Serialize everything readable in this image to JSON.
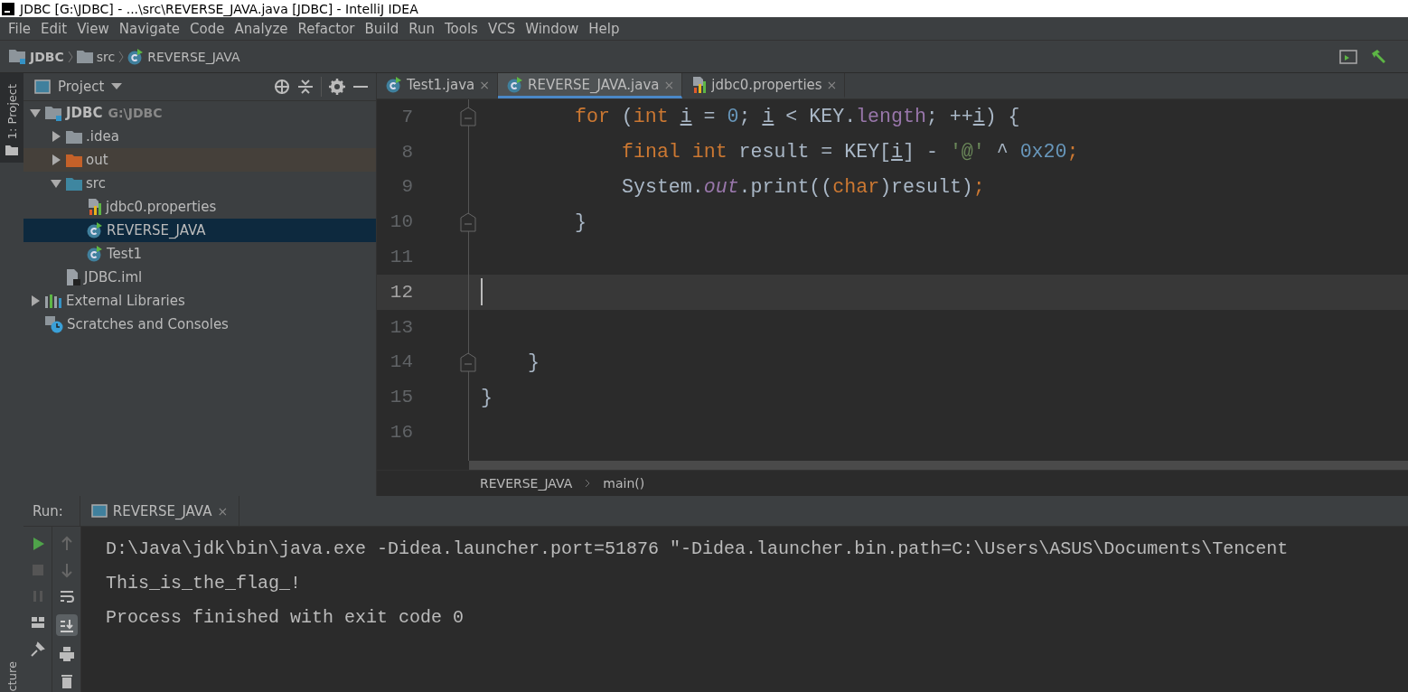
{
  "window": {
    "title": "JDBC [G:\\JDBC] - ...\\src\\REVERSE_JAVA.java [JDBC] - IntelliJ IDEA"
  },
  "menu": [
    "File",
    "Edit",
    "View",
    "Navigate",
    "Code",
    "Analyze",
    "Refactor",
    "Build",
    "Run",
    "Tools",
    "VCS",
    "Window",
    "Help"
  ],
  "navbar": [
    {
      "label": "JDBC",
      "kind": "project"
    },
    {
      "label": "src",
      "kind": "folder"
    },
    {
      "label": "REVERSE_JAVA",
      "kind": "class"
    }
  ],
  "side_strip": {
    "top": "1: Project",
    "bottom": "cture"
  },
  "project_panel": {
    "title": "Project",
    "tree": [
      {
        "label": "JDBC",
        "hint": "G:\\JDBC",
        "kind": "project",
        "expanded": true,
        "selected": false,
        "children": [
          {
            "label": ".idea",
            "kind": "folder",
            "expanded": false,
            "selected": false
          },
          {
            "label": "out",
            "kind": "excluded",
            "expanded": false,
            "selected": false
          },
          {
            "label": "src",
            "kind": "source",
            "expanded": true,
            "selected": false,
            "children": [
              {
                "label": "jdbc0.properties",
                "kind": "properties",
                "selected": false
              },
              {
                "label": "REVERSE_JAVA",
                "kind": "class",
                "selected": true
              },
              {
                "label": "Test1",
                "kind": "class",
                "selected": false
              }
            ]
          },
          {
            "label": "JDBC.iml",
            "kind": "module",
            "selected": false
          }
        ]
      },
      {
        "label": "External Libraries",
        "kind": "libraries",
        "expanded": false,
        "selected": false
      },
      {
        "label": "Scratches and Consoles",
        "kind": "scratches",
        "selected": false
      }
    ]
  },
  "editor_tabs": [
    {
      "label": "Test1.java",
      "kind": "class",
      "selected": false,
      "close": "×"
    },
    {
      "label": "REVERSE_JAVA.java",
      "kind": "class",
      "selected": true,
      "close": "×"
    },
    {
      "label": "jdbc0.properties",
      "kind": "properties",
      "selected": false,
      "close": "×"
    }
  ],
  "code": [
    {
      "children": [
        {
          "children": [
            {
              "number": "7",
              "fold": true,
              "current": false,
              "tokens": [
                {
                  "kind": "keyword",
                  "text": "for"
                },
                {
                  "kind": "plain",
                  "text": " ("
                },
                {
                  "kind": "keyword",
                  "text": "int "
                },
                {
                  "kind": "var",
                  "text": "i"
                },
                {
                  "kind": "plain",
                  "text": " = "
                },
                {
                  "kind": "number",
                  "text": "0"
                },
                {
                  "kind": "plain",
                  "text": "; "
                },
                {
                  "kind": "var",
                  "text": "i"
                },
                {
                  "kind": "plain",
                  "text": " < KEY."
                },
                {
                  "kind": "field",
                  "text": "length"
                },
                {
                  "kind": "plain",
                  "text": "; ++"
                },
                {
                  "kind": "var",
                  "text": "i"
                },
                {
                  "kind": "plain",
                  "text": ") {"
                }
              ],
              "children": [
                {
                  "number": "8",
                  "fold": false,
                  "current": false,
                  "tokens": [
                    {
                      "kind": "keyword",
                      "text": "final int "
                    },
                    {
                      "kind": "plain",
                      "text": "result = KEY["
                    },
                    {
                      "kind": "var",
                      "text": "i"
                    },
                    {
                      "kind": "plain",
                      "text": "] - "
                    },
                    {
                      "kind": "string",
                      "text": "'@'"
                    },
                    {
                      "kind": "plain",
                      "text": " ^ "
                    },
                    {
                      "kind": "number",
                      "text": "0x20"
                    },
                    {
                      "kind": "keyword",
                      "text": ";"
                    }
                  ]
                },
                {
                  "number": "9",
                  "fold": false,
                  "current": false,
                  "tokens": [
                    {
                      "kind": "plain",
                      "text": "System."
                    },
                    {
                      "kind": "static",
                      "text": "out"
                    },
                    {
                      "kind": "plain",
                      "text": ".print(("
                    },
                    {
                      "kind": "keyword",
                      "text": "char"
                    },
                    {
                      "kind": "plain",
                      "text": ")result)"
                    },
                    {
                      "kind": "keyword",
                      "text": ";"
                    }
                  ]
                }
              ]
            },
            {
              "number": "10",
              "fold": true,
              "current": false,
              "tokens": [
                {
                  "kind": "plain",
                  "text": "}"
                }
              ]
            },
            {
              "number": "11",
              "fold": false,
              "current": false
            },
            {
              "number": "12",
              "fold": false,
              "current": true
            },
            {
              "number": "13",
              "fold": false,
              "current": false
            }
          ]
        },
        {
          "number": "14",
          "fold": true,
          "current": false,
          "tokens": [
            {
              "kind": "plain",
              "text": "}"
            }
          ]
        }
      ]
    },
    {
      "number": "15",
      "fold": false,
      "current": false,
      "tokens": [
        {
          "kind": "plain",
          "text": "}"
        }
      ]
    },
    {
      "number": "16",
      "fold": false,
      "current": false
    }
  ],
  "editor_breadcrumb": [
    "REVERSE_JAVA",
    "main()"
  ],
  "run_panel": {
    "label": "Run:",
    "tab": "REVERSE_JAVA",
    "tab_close": "×",
    "output": [
      "D:\\Java\\jdk\\bin\\java.exe -Didea.launcher.port=51876 \"-Didea.launcher.bin.path=C:\\Users\\ASUS\\Documents\\Tencent",
      "This_is_the_flag_!",
      "Process finished with exit code 0"
    ]
  }
}
